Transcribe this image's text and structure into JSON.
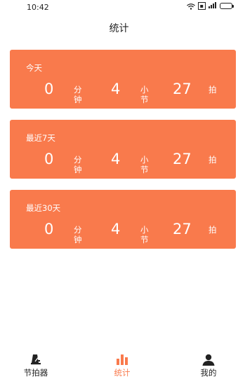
{
  "status_bar": {
    "time": "10:42"
  },
  "header": {
    "title": "统计"
  },
  "cards": [
    {
      "title": "今天",
      "minutes": "0",
      "minutes_unit": "分钟",
      "bars": "4",
      "bars_unit": "小节",
      "beats": "27",
      "beats_unit": "拍"
    },
    {
      "title": "最近7天",
      "minutes": "0",
      "minutes_unit": "分钟",
      "bars": "4",
      "bars_unit": "小节",
      "beats": "27",
      "beats_unit": "拍"
    },
    {
      "title": "最近30天",
      "minutes": "0",
      "minutes_unit": "分钟",
      "bars": "4",
      "bars_unit": "小节",
      "beats": "27",
      "beats_unit": "拍"
    }
  ],
  "tabs": [
    {
      "label": "节拍器",
      "icon": "metronome-icon"
    },
    {
      "label": "统计",
      "icon": "bar-chart-icon",
      "active": true
    },
    {
      "label": "我的",
      "icon": "user-icon"
    }
  ],
  "colors": {
    "accent": "#f97a4c",
    "text": "#222222",
    "background": "#ffffff"
  }
}
